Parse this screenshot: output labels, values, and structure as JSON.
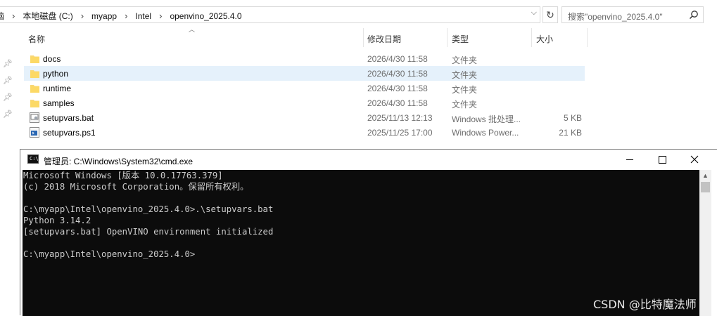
{
  "explorer": {
    "breadcrumbs": [
      "本地磁盘 (C:)",
      "myapp",
      "Intel",
      "openvino_2025.4.0"
    ],
    "breadcrumb_prefix": "脑",
    "search_placeholder": "搜索\"openvino_2025.4.0\"",
    "columns": {
      "name": "名称",
      "date": "修改日期",
      "type": "类型",
      "size": "大小"
    },
    "rows": [
      {
        "name": "docs",
        "date": "2026/4/30 11:58",
        "type": "文件夹",
        "size": "",
        "icon": "folder-icon"
      },
      {
        "name": "python",
        "date": "2026/4/30 11:58",
        "type": "文件夹",
        "size": "",
        "icon": "folder-icon",
        "selected": true
      },
      {
        "name": "runtime",
        "date": "2026/4/30 11:58",
        "type": "文件夹",
        "size": "",
        "icon": "folder-icon"
      },
      {
        "name": "samples",
        "date": "2026/4/30 11:58",
        "type": "文件夹",
        "size": "",
        "icon": "folder-icon"
      },
      {
        "name": "setupvars.bat",
        "date": "2025/11/13 12:13",
        "type": "Windows 批处理...",
        "size": "5 KB",
        "icon": "batch-file-icon"
      },
      {
        "name": "setupvars.ps1",
        "date": "2025/11/25 17:00",
        "type": "Windows Power...",
        "size": "21 KB",
        "icon": "powershell-file-icon"
      }
    ]
  },
  "cmd": {
    "title": "管理员: C:\\Windows\\System32\\cmd.exe",
    "lines": [
      "Microsoft Windows [版本 10.0.17763.379]",
      "(c) 2018 Microsoft Corporation。保留所有权利。",
      "",
      "C:\\myapp\\Intel\\openvino_2025.4.0>.\\setupvars.bat",
      "Python 3.14.2",
      "[setupvars.bat] OpenVINO environment initialized",
      "",
      "C:\\myapp\\Intel\\openvino_2025.4.0>"
    ]
  },
  "watermark": "CSDN @比特魔法师",
  "colors": {
    "selected_row": "#e5f1fb",
    "console_bg": "#0c0c0c",
    "console_text": "#cccccc",
    "folder": "#f8d775"
  }
}
